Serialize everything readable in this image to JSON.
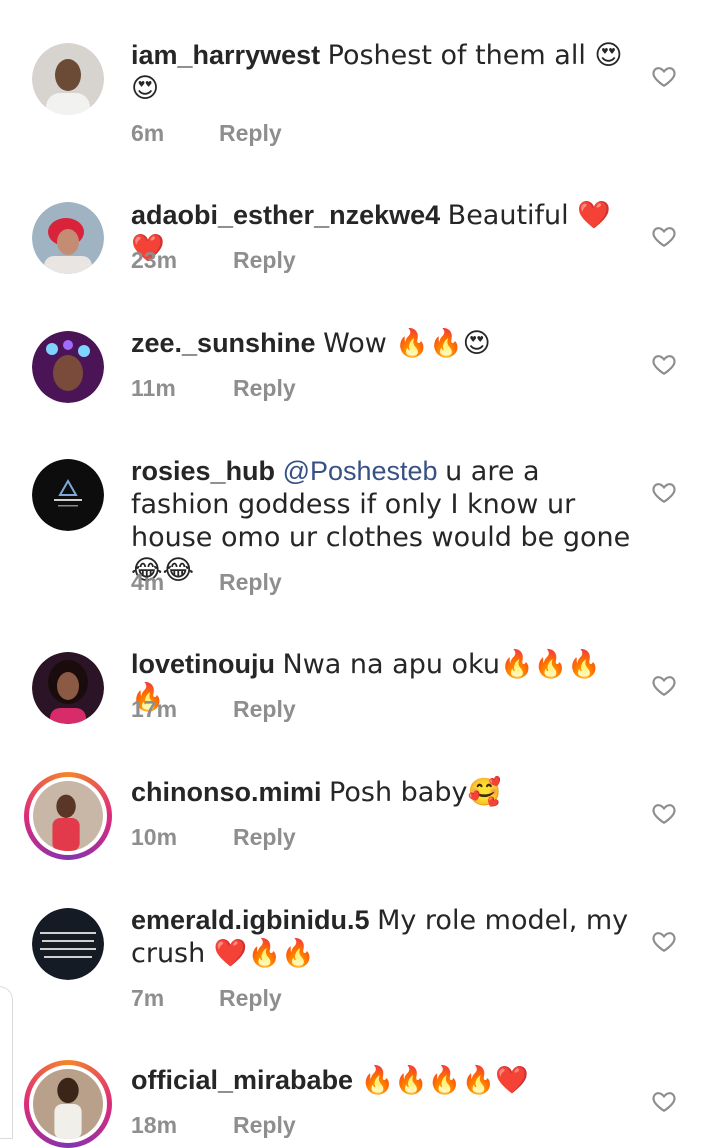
{
  "comments": [
    {
      "username": "iam_harrywest",
      "mention": "",
      "text": "Poshest of them all 😍😍",
      "time": "6m",
      "reply": "Reply"
    },
    {
      "username": "adaobi_esther_nzekwe4",
      "mention": "",
      "text": "Beautiful ❤️❤️",
      "time": "23m",
      "reply": "Reply"
    },
    {
      "username": "zee._sunshine",
      "mention": "",
      "text": "Wow 🔥🔥😍",
      "time": "11m",
      "reply": "Reply"
    },
    {
      "username": "rosies_hub",
      "mention": "@Poshesteb",
      "text": "u are a fashion goddess if only I know ur house omo ur clothes would be gone 😂😂",
      "time": "4m",
      "reply": "Reply"
    },
    {
      "username": "lovetinouju",
      "mention": "",
      "text": "Nwa na apu oku🔥🔥🔥🔥",
      "time": "17m",
      "reply": "Reply"
    },
    {
      "username": "chinonso.mimi",
      "mention": "",
      "text": "Posh baby🥰",
      "time": "10m",
      "reply": "Reply"
    },
    {
      "username": "emerald.igbinidu.5",
      "mention": "",
      "text": "My role model, my crush ❤️🔥🔥",
      "time": "7m",
      "reply": "Reply"
    },
    {
      "username": "official_mirababe",
      "mention": "",
      "text": "🔥🔥🔥🔥❤️",
      "time": "18m",
      "reply": "Reply"
    }
  ],
  "colors": {
    "username": "#262626",
    "meta": "#8e8e8e",
    "mention": "#385185",
    "heart_outline": "#8e8e8e"
  },
  "icons": {
    "like": "heart-outline-icon"
  }
}
